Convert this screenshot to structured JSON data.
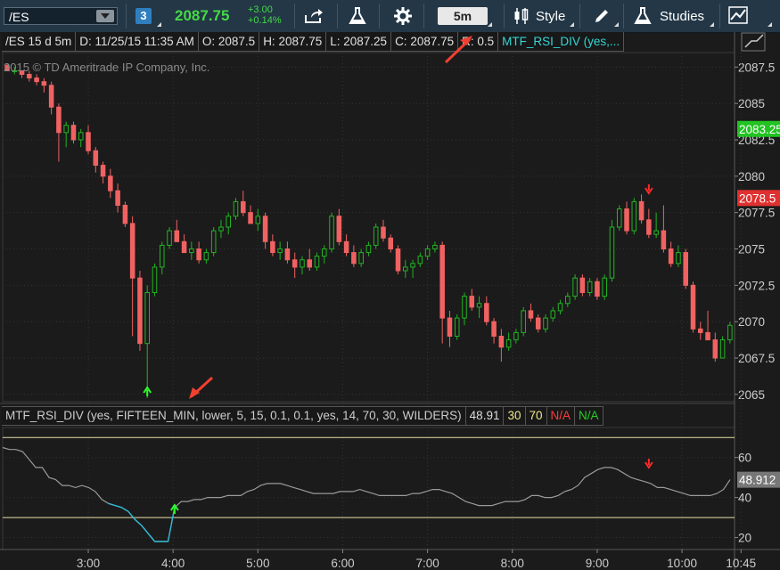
{
  "toolbar": {
    "symbol": "/ES",
    "link_badge": "3",
    "last_price": "2087.75",
    "change": "+3.00",
    "change_pct": "+0.14%",
    "timeframe": "5m",
    "style_label": "Style",
    "studies_label": "Studies"
  },
  "info_bar": {
    "symbol_period": "/ES 15 d 5m",
    "date": "D: 11/25/15 11:35 AM",
    "open": "O: 2087.5",
    "high": "H: 2087.75",
    "low": "L: 2087.25",
    "close": "C: 2087.75",
    "range": "R: 0.5",
    "study": "MTF_RSI_DIV (yes,..."
  },
  "copyright": "2015 © TD Ameritrade IP Company, Inc.",
  "lower_panel": {
    "study_label": "MTF_RSI_DIV (yes, FIFTEEN_MIN, lower, 5, 15, 0.1, 0.1, yes, 14, 70, 30, WILDERS)",
    "value": "48.91",
    "lower_level": "30",
    "upper_level": "70",
    "na_red": "N/A",
    "na_green": "N/A",
    "value_tag": "48.912"
  },
  "colors": {
    "up": "#22b422",
    "down": "#f06262",
    "lower_line": "#9a9a9a",
    "lower_line_os": "#2fb8d6",
    "levels": "#e8e0a8",
    "last_tag": "#22c322",
    "mark_tag": "#e03030"
  },
  "chart_data": {
    "type": "candlestick",
    "price_axis": {
      "ticks": [
        "2087.5",
        "2085",
        "2082.5",
        "2080",
        "2077.5",
        "2075",
        "2072.5",
        "2070",
        "2067.5",
        "2065"
      ],
      "range": [
        2064.5,
        2088.5
      ],
      "last_price_tag": "2083.25",
      "mark_price_tag": "2078.5"
    },
    "time_axis": {
      "ticks": [
        "3:00",
        "4:00",
        "5:00",
        "6:00",
        "7:00",
        "8:00",
        "9:00",
        "10:00",
        "10:45"
      ]
    },
    "candles": [
      [
        2087.6,
        2087.75,
        2087.25,
        2087.25
      ],
      [
        2087.25,
        2087.5,
        2087.0,
        2087.25
      ],
      [
        2087.25,
        2087.25,
        2086.75,
        2087.0
      ],
      [
        2087.0,
        2087.25,
        2086.5,
        2086.75
      ],
      [
        2086.75,
        2087.0,
        2086.25,
        2086.5
      ],
      [
        2086.5,
        2086.75,
        2085.75,
        2086.25
      ],
      [
        2086.25,
        2086.5,
        2084.25,
        2084.75
      ],
      [
        2084.75,
        2085.0,
        2081.0,
        2083.0
      ],
      [
        2083.0,
        2083.75,
        2082.0,
        2083.5
      ],
      [
        2083.5,
        2083.75,
        2082.25,
        2082.5
      ],
      [
        2082.5,
        2083.25,
        2082.0,
        2083.0
      ],
      [
        2083.0,
        2083.5,
        2081.5,
        2081.75
      ],
      [
        2081.75,
        2082.0,
        2080.25,
        2080.75
      ],
      [
        2080.75,
        2081.0,
        2079.5,
        2080.0
      ],
      [
        2080.0,
        2080.5,
        2078.5,
        2079.0
      ],
      [
        2079.0,
        2079.5,
        2077.5,
        2078.0
      ],
      [
        2078.0,
        2078.25,
        2076.5,
        2076.75
      ],
      [
        2076.75,
        2077.25,
        2069.0,
        2073.0
      ],
      [
        2073.0,
        2073.5,
        2068.0,
        2068.5
      ],
      [
        2068.5,
        2072.5,
        2064.75,
        2072.0
      ],
      [
        2072.0,
        2074.0,
        2071.75,
        2073.75
      ],
      [
        2073.75,
        2075.5,
        2073.25,
        2075.25
      ],
      [
        2075.25,
        2076.5,
        2075.0,
        2076.25
      ],
      [
        2076.25,
        2077.0,
        2075.75,
        2075.5
      ],
      [
        2075.5,
        2076.0,
        2074.75,
        2074.75
      ],
      [
        2074.75,
        2075.5,
        2074.25,
        2075.0
      ],
      [
        2075.0,
        2075.5,
        2074.0,
        2074.25
      ],
      [
        2074.25,
        2075.0,
        2074.0,
        2074.75
      ],
      [
        2074.75,
        2076.5,
        2074.5,
        2076.25
      ],
      [
        2076.25,
        2077.0,
        2075.75,
        2076.5
      ],
      [
        2076.5,
        2077.5,
        2076.0,
        2077.25
      ],
      [
        2077.25,
        2078.5,
        2077.0,
        2078.25
      ],
      [
        2078.25,
        2079.0,
        2077.25,
        2077.5
      ],
      [
        2077.5,
        2078.0,
        2076.75,
        2076.75
      ],
      [
        2076.75,
        2077.75,
        2076.25,
        2077.25
      ],
      [
        2077.25,
        2077.5,
        2075.0,
        2075.5
      ],
      [
        2075.5,
        2076.0,
        2074.5,
        2074.75
      ],
      [
        2074.75,
        2075.5,
        2074.25,
        2075.0
      ],
      [
        2075.0,
        2075.5,
        2074.0,
        2074.25
      ],
      [
        2074.25,
        2074.75,
        2073.0,
        2073.75
      ],
      [
        2073.75,
        2074.5,
        2073.25,
        2074.25
      ],
      [
        2074.25,
        2075.0,
        2073.5,
        2073.75
      ],
      [
        2073.75,
        2074.75,
        2073.5,
        2074.5
      ],
      [
        2074.5,
        2075.25,
        2074.0,
        2075.0
      ],
      [
        2075.0,
        2077.5,
        2074.75,
        2077.25
      ],
      [
        2077.25,
        2077.75,
        2075.25,
        2075.5
      ],
      [
        2075.5,
        2076.0,
        2074.5,
        2074.75
      ],
      [
        2074.75,
        2075.25,
        2073.75,
        2074.0
      ],
      [
        2074.0,
        2075.0,
        2073.75,
        2074.75
      ],
      [
        2074.75,
        2075.5,
        2074.5,
        2075.25
      ],
      [
        2075.25,
        2076.75,
        2075.0,
        2076.5
      ],
      [
        2076.5,
        2077.0,
        2075.5,
        2075.75
      ],
      [
        2075.75,
        2076.0,
        2074.75,
        2075.0
      ],
      [
        2075.0,
        2075.25,
        2073.25,
        2073.5
      ],
      [
        2073.5,
        2074.25,
        2073.0,
        2073.75
      ],
      [
        2073.75,
        2074.25,
        2073.0,
        2074.0
      ],
      [
        2074.0,
        2074.75,
        2073.75,
        2074.5
      ],
      [
        2074.5,
        2075.25,
        2074.25,
        2075.0
      ],
      [
        2075.0,
        2075.5,
        2074.75,
        2075.25
      ],
      [
        2075.25,
        2075.5,
        2068.5,
        2070.25
      ],
      [
        2070.25,
        2070.75,
        2068.25,
        2069.0
      ],
      [
        2069.0,
        2070.5,
        2068.75,
        2070.25
      ],
      [
        2070.25,
        2072.0,
        2069.75,
        2071.75
      ],
      [
        2071.75,
        2072.25,
        2070.75,
        2071.0
      ],
      [
        2071.0,
        2071.75,
        2070.25,
        2071.25
      ],
      [
        2071.25,
        2071.75,
        2069.75,
        2070.0
      ],
      [
        2070.0,
        2070.25,
        2068.5,
        2069.0
      ],
      [
        2069.0,
        2069.5,
        2067.25,
        2068.25
      ],
      [
        2068.25,
        2069.25,
        2068.0,
        2068.75
      ],
      [
        2068.75,
        2069.5,
        2068.5,
        2069.25
      ],
      [
        2069.25,
        2071.0,
        2069.0,
        2070.75
      ],
      [
        2070.75,
        2071.25,
        2070.0,
        2070.25
      ],
      [
        2070.25,
        2070.5,
        2069.25,
        2069.5
      ],
      [
        2069.5,
        2070.5,
        2069.25,
        2070.25
      ],
      [
        2070.25,
        2071.0,
        2070.0,
        2070.75
      ],
      [
        2070.75,
        2071.5,
        2070.5,
        2071.25
      ],
      [
        2071.25,
        2072.0,
        2071.0,
        2071.75
      ],
      [
        2071.75,
        2073.25,
        2071.5,
        2073.0
      ],
      [
        2073.0,
        2073.25,
        2071.75,
        2072.0
      ],
      [
        2072.0,
        2073.0,
        2071.75,
        2072.75
      ],
      [
        2072.75,
        2073.0,
        2071.5,
        2071.75
      ],
      [
        2071.75,
        2073.25,
        2071.5,
        2073.0
      ],
      [
        2073.0,
        2077.0,
        2072.75,
        2076.5
      ],
      [
        2076.5,
        2078.0,
        2076.25,
        2077.75
      ],
      [
        2077.75,
        2078.25,
        2076.0,
        2076.25
      ],
      [
        2076.25,
        2078.5,
        2076.0,
        2078.25
      ],
      [
        2078.25,
        2078.75,
        2076.75,
        2077.0
      ],
      [
        2077.0,
        2077.75,
        2075.75,
        2076.0
      ],
      [
        2076.0,
        2077.5,
        2075.75,
        2076.25
      ],
      [
        2076.25,
        2078.0,
        2074.75,
        2075.0
      ],
      [
        2075.0,
        2075.5,
        2073.75,
        2074.0
      ],
      [
        2074.0,
        2075.25,
        2073.75,
        2074.75
      ],
      [
        2074.75,
        2075.0,
        2072.25,
        2072.5
      ],
      [
        2072.5,
        2072.75,
        2069.25,
        2069.5
      ],
      [
        2069.5,
        2070.0,
        2068.75,
        2069.25
      ],
      [
        2069.25,
        2070.75,
        2068.75,
        2068.75
      ],
      [
        2068.75,
        2069.25,
        2067.25,
        2067.5
      ],
      [
        2067.5,
        2069.0,
        2067.5,
        2068.75
      ],
      [
        2068.75,
        2070.0,
        2068.5,
        2069.75
      ]
    ],
    "lower_study": {
      "type": "line",
      "y_axis_ticks": [
        "60",
        "40",
        "20"
      ],
      "y_range": [
        14,
        75
      ],
      "levels": [
        70,
        30
      ],
      "values": [
        65,
        64,
        64,
        63,
        59,
        55,
        55,
        50,
        49,
        46,
        46,
        45,
        46,
        45,
        43,
        39,
        37,
        36,
        35,
        33,
        29,
        26,
        22,
        18,
        18,
        18,
        35,
        38,
        38,
        39,
        39,
        40,
        40,
        40,
        41,
        41,
        41,
        43,
        44,
        46,
        47,
        47,
        47,
        46,
        45,
        44,
        43,
        42,
        42,
        42,
        42,
        43,
        43,
        43,
        44,
        43,
        42,
        41,
        41,
        41,
        41,
        41,
        42,
        42,
        43,
        44,
        44,
        43,
        42,
        40,
        38,
        37,
        36,
        36,
        36,
        37,
        38,
        38,
        38,
        39,
        41,
        41,
        40,
        40,
        41,
        43,
        44,
        46,
        50,
        52,
        54,
        55,
        55,
        54,
        52,
        50,
        49,
        48,
        47,
        45,
        45,
        44,
        43,
        42,
        41,
        41,
        41,
        41,
        42,
        44,
        48.9
      ]
    }
  }
}
